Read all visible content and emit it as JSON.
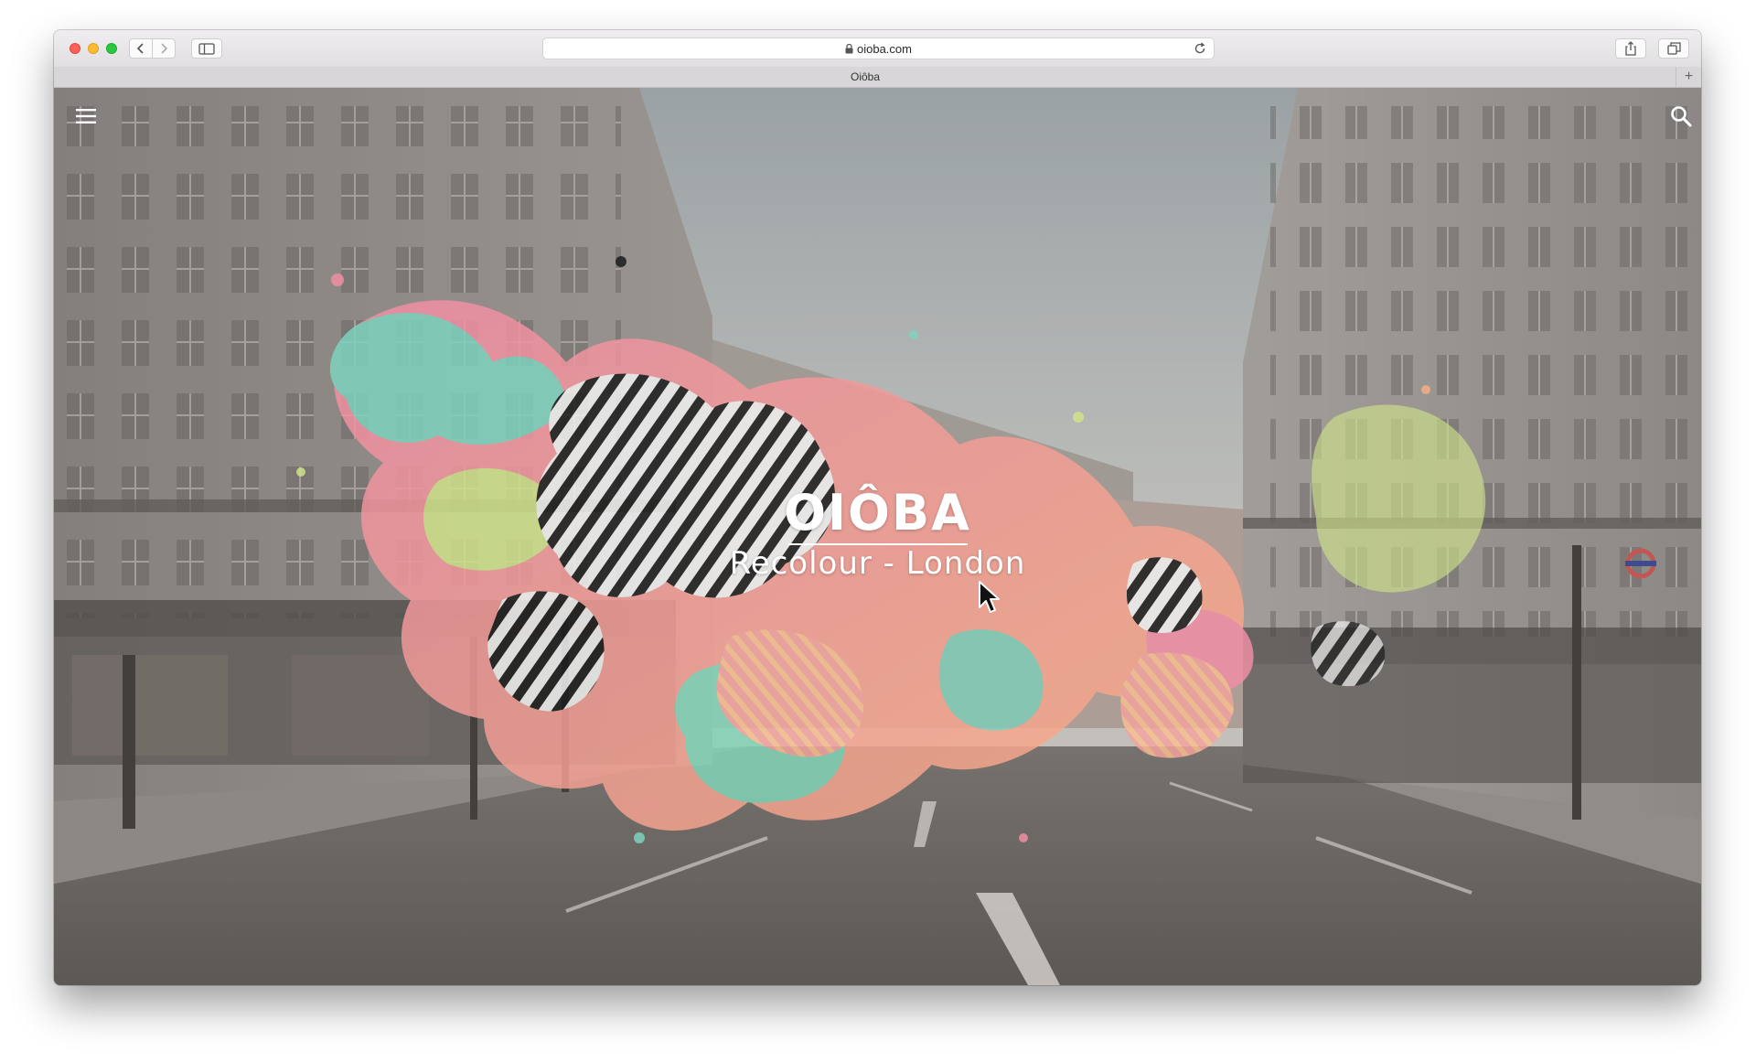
{
  "browser": {
    "url": "oioba.com",
    "tab_title": "Oiôba",
    "new_tab_label": "+"
  },
  "toolbar_icons": {
    "close": "close-traffic-light",
    "minimize": "minimize-traffic-light",
    "zoom": "zoom-traffic-light",
    "back": "chevron-left-icon",
    "forward": "chevron-right-icon",
    "sidebar": "sidebar-icon",
    "lock": "lock-icon",
    "reload": "reload-icon",
    "share": "share-icon",
    "tabs": "tabs-overview-icon"
  },
  "site": {
    "brand": "OIÔBA",
    "tagline": "Recolour - London",
    "menu_icon": "hamburger-menu-icon",
    "search_icon": "search-icon"
  },
  "colors": {
    "traffic_red": "#fe5f57",
    "traffic_yellow": "#febc2e",
    "traffic_green": "#28c840",
    "splash_teal": "#7fd3bf",
    "splash_pink": "#ef8fa3",
    "splash_peach": "#f7a98a",
    "splash_lime": "#cfe28a",
    "text": "#ffffff"
  }
}
